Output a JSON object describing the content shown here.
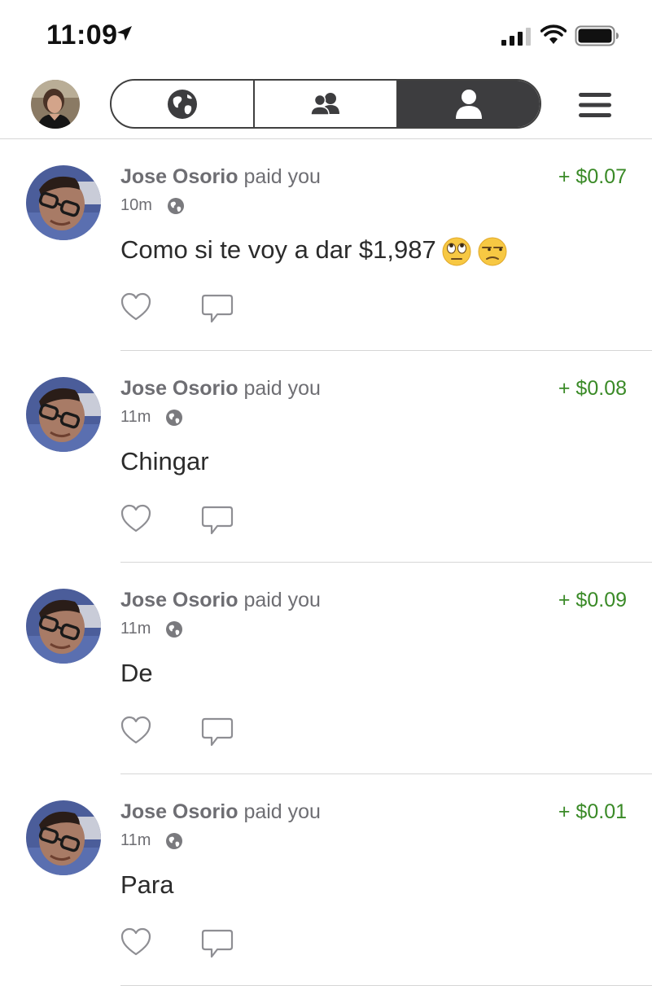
{
  "status_bar": {
    "time": "11:09",
    "icons": [
      "location-arrow-icon",
      "cellular-signal-icon",
      "wifi-icon",
      "battery-icon"
    ]
  },
  "nav": {
    "tabs": [
      {
        "icon": "globe-icon",
        "active": false
      },
      {
        "icon": "friends-icon",
        "active": false
      },
      {
        "icon": "person-icon",
        "active": true
      }
    ],
    "menu_icon": "hamburger-menu-icon"
  },
  "colors": {
    "amount_green": "#3a8a27",
    "segment_active": "#3d3d3f",
    "meta_gray": "#6e6e73"
  },
  "stories": [
    {
      "name": "Jose Osorio",
      "action": " paid you",
      "amount": "+ $0.07",
      "time": "10m",
      "message": "Como si te voy a dar $1,987",
      "emojis": [
        "face-with-rolling-eyes",
        "unamused-face"
      ]
    },
    {
      "name": "Jose Osorio",
      "action": " paid you",
      "amount": "+ $0.08",
      "time": "11m",
      "message": "Chingar",
      "emojis": []
    },
    {
      "name": "Jose Osorio",
      "action": " paid you",
      "amount": "+ $0.09",
      "time": "11m",
      "message": "De",
      "emojis": []
    },
    {
      "name": "Jose Osorio",
      "action": " paid you",
      "amount": "+ $0.01",
      "time": "11m",
      "message": "Para",
      "emojis": []
    }
  ]
}
